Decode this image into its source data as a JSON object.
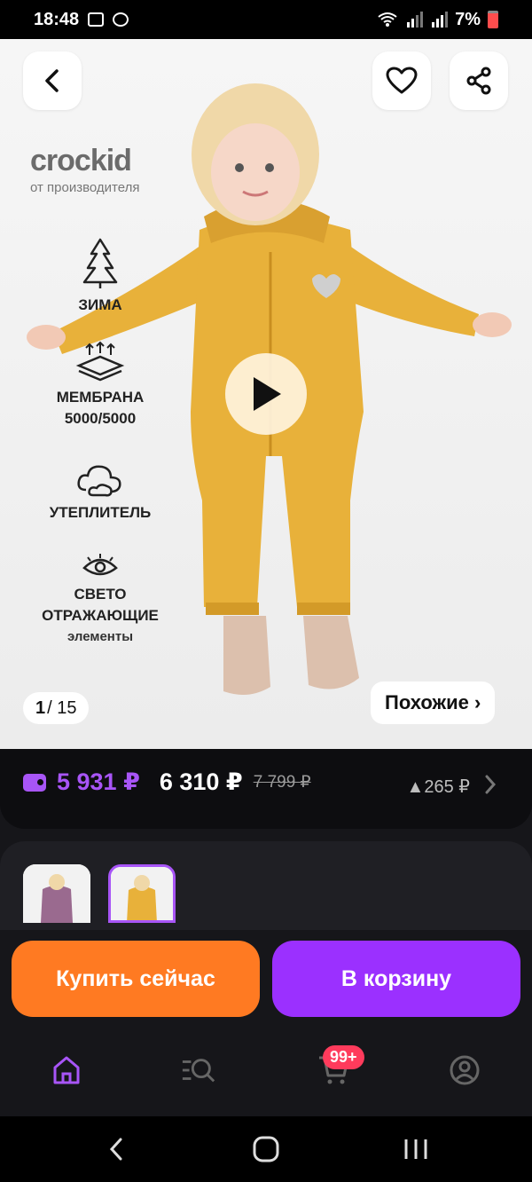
{
  "status_bar": {
    "time": "18:48",
    "battery": "7%"
  },
  "product": {
    "brand_logo": "crockid",
    "brand_sub": "от производителя",
    "features": [
      {
        "label": "ЗИМА",
        "icon": "snow-tree-icon"
      },
      {
        "label": "МЕМБРАНА 5000/5000",
        "icon": "membrane-icon"
      },
      {
        "label": "УТЕПЛИТЕЛЬ",
        "icon": "cloud-icon"
      },
      {
        "label1": "СВЕТО",
        "label2": "ОТРАЖАЮЩИЕ",
        "label3": "элементы",
        "icon": "eye-icon"
      }
    ],
    "image_counter": {
      "current": "1",
      "total": "/ 15"
    },
    "similar_label": "Похожие ›"
  },
  "price": {
    "wallet_price": "5 931 ₽",
    "price": "6 310 ₽",
    "old_price": "7 799 ₽",
    "delta": "▲265 ₽"
  },
  "actions": {
    "buy_now": "Купить сейчас",
    "add_to_cart": "В корзину"
  },
  "tabbar": {
    "cart_badge": "99+"
  },
  "colors": {
    "accent": "#a855f7",
    "buy": "#ff7a22",
    "cart": "#9b30ff",
    "jumpsuit": "#e8b13a"
  }
}
